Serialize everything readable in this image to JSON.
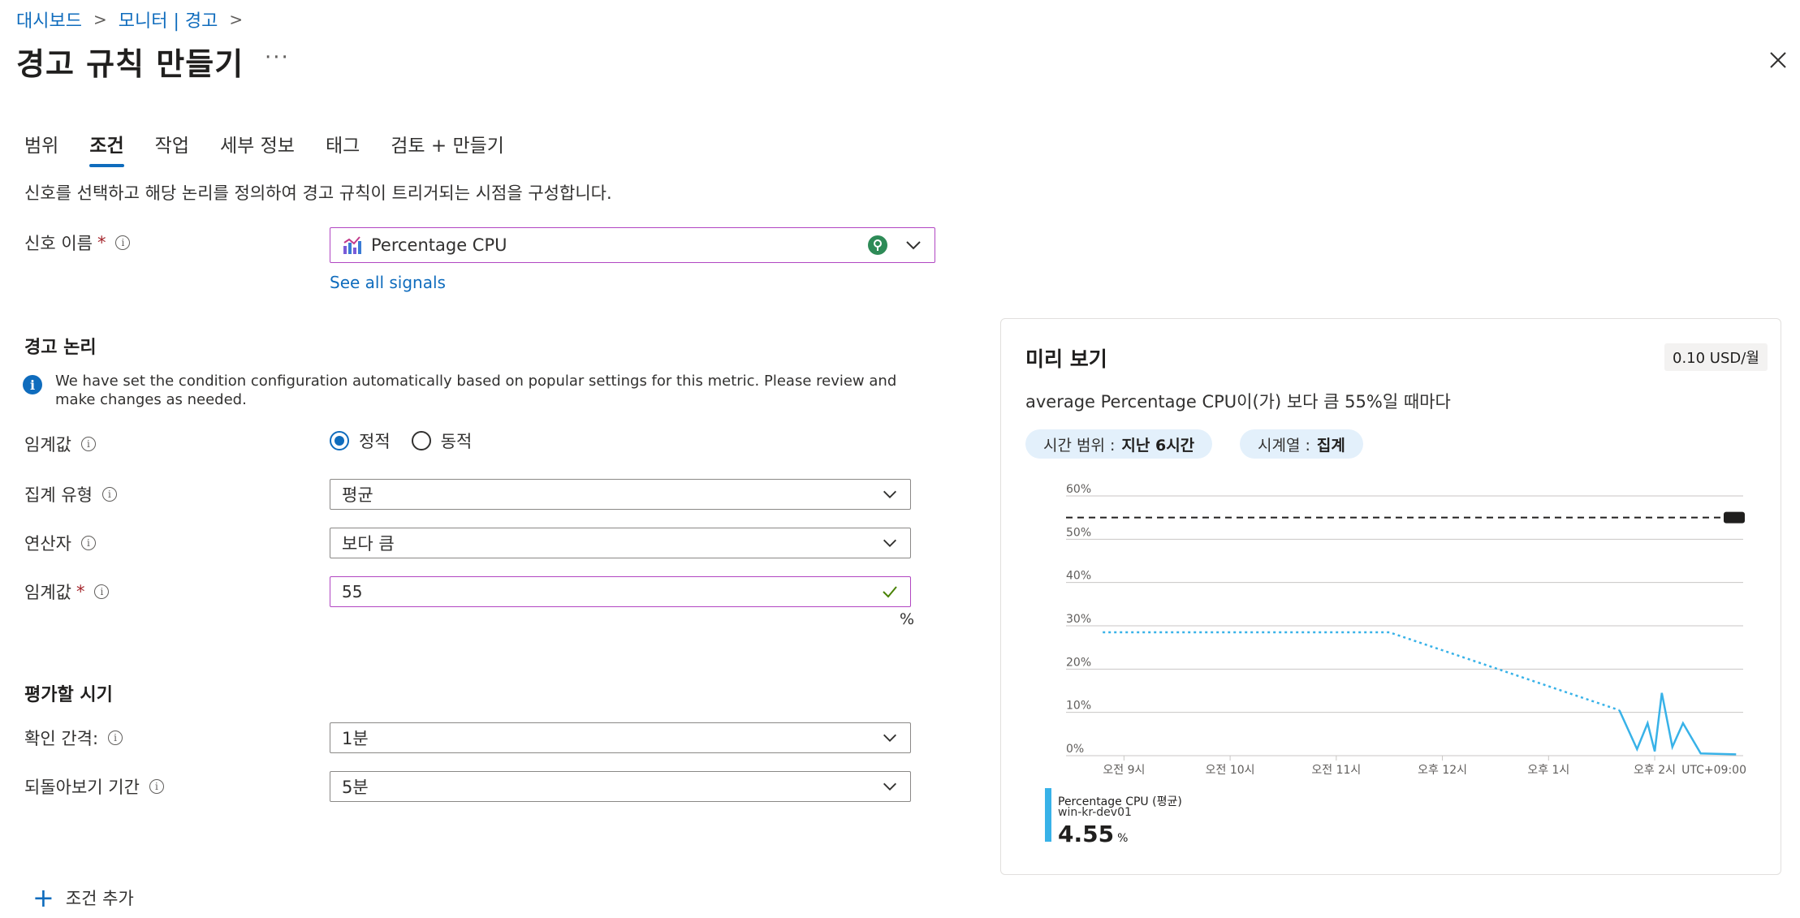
{
  "breadcrumb": [
    {
      "label": "대시보드"
    },
    {
      "label": "모니터 | 경고"
    }
  ],
  "page_title": "경고 규칙 만들기",
  "more_label": "···",
  "tabs": [
    {
      "label": "범위",
      "active": false
    },
    {
      "label": "조건",
      "active": true
    },
    {
      "label": "작업",
      "active": false
    },
    {
      "label": "세부 정보",
      "active": false
    },
    {
      "label": "태그",
      "active": false
    },
    {
      "label": "검토 + 만들기",
      "active": false
    }
  ],
  "intro": "신호를 선택하고 해당 논리를 정의하여 경고 규칙이 트리거되는 시점을 구성합니다.",
  "signal": {
    "label": "신호 이름",
    "value": "Percentage CPU",
    "see_all": "See all signals"
  },
  "alert_logic": {
    "heading": "경고 논리",
    "notice": "We have set the condition configuration automatically based on popular settings for this metric. Please review and make changes as needed.",
    "threshold_type_label": "임계값",
    "threshold_options": [
      "정적",
      "동적"
    ],
    "threshold_selected": "정적",
    "aggregation_label": "집계 유형",
    "aggregation_value": "평균",
    "operator_label": "연산자",
    "operator_value": "보다 큼",
    "threshold_value_label": "임계값",
    "threshold_value": "55",
    "threshold_unit": "%"
  },
  "evaluation": {
    "heading": "평가할 시기",
    "check_every_label": "확인 간격:",
    "check_every_value": "1분",
    "lookback_label": "되돌아보기 기간",
    "lookback_value": "5분"
  },
  "add_condition": "조건 추가",
  "preview": {
    "title": "미리 보기",
    "cost": "0.10 USD/월",
    "description": "average Percentage CPU이(가) 보다 큼 55%일 때마다",
    "time_range_label": "시간 범위 :",
    "time_range_value": "지난 6시간",
    "series_label": "시계열 :",
    "series_value": "집계"
  },
  "chart_data": {
    "type": "line",
    "y_ticks": [
      "60%",
      "50%",
      "40%",
      "30%",
      "20%",
      "10%",
      "0%"
    ],
    "ylim": [
      0,
      60
    ],
    "x_ticks": [
      "오전 9시",
      "오전 10시",
      "오전 11시",
      "오후 12시",
      "오후 1시",
      "오후 2시"
    ],
    "timezone": "UTC+09:00",
    "threshold": 55,
    "series": [
      {
        "name": "Percentage CPU (평균)",
        "resource": "win-kr-dev01",
        "color": "#38b2e8",
        "points": [
          {
            "t": "08:48",
            "v": 28.5,
            "style": "dotted"
          },
          {
            "t": "11:30",
            "v": 28.5,
            "style": "dotted"
          },
          {
            "t": "13:40",
            "v": 10.5,
            "style": "dotted"
          },
          {
            "t": "13:40",
            "v": 10.5,
            "style": "solid"
          },
          {
            "t": "13:50",
            "v": 1.5,
            "style": "solid"
          },
          {
            "t": "13:56",
            "v": 7.5,
            "style": "solid"
          },
          {
            "t": "14:00",
            "v": 1,
            "style": "solid"
          },
          {
            "t": "14:04",
            "v": 14.5,
            "style": "solid"
          },
          {
            "t": "14:10",
            "v": 2,
            "style": "solid"
          },
          {
            "t": "14:16",
            "v": 7.5,
            "style": "solid"
          },
          {
            "t": "14:26",
            "v": 0.5,
            "style": "solid"
          },
          {
            "t": "14:46",
            "v": 0.3,
            "style": "solid"
          }
        ],
        "last_value": "4.55",
        "unit": "%"
      }
    ]
  }
}
